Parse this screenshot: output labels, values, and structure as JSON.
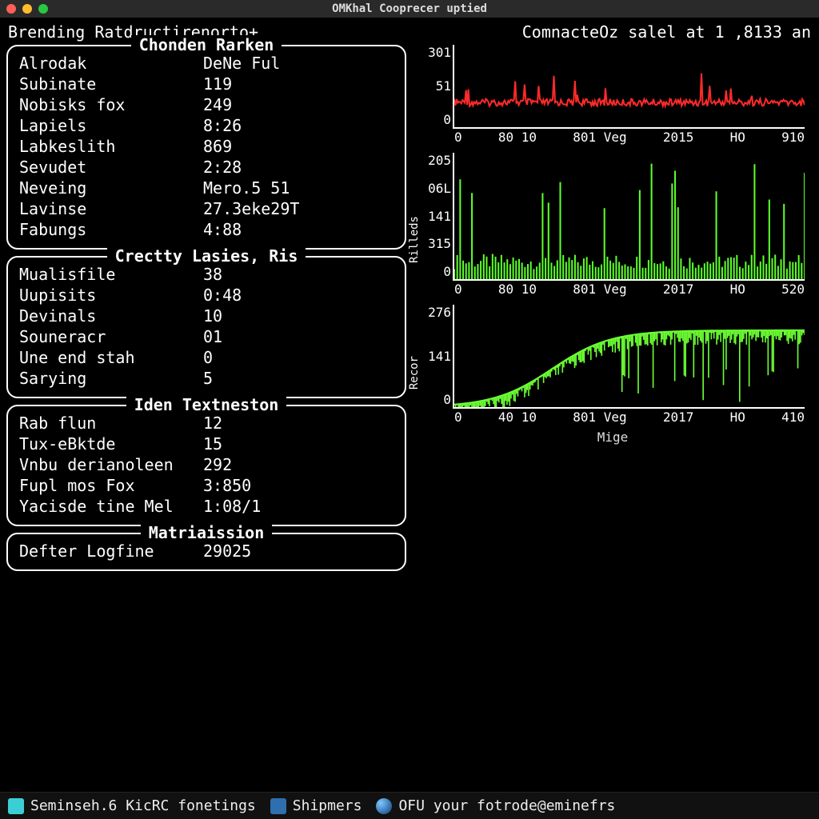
{
  "window": {
    "title": "OMKhal Cooprecer uptied"
  },
  "header": {
    "left": "Brending Ratdructirenorto+",
    "right": "ComnacteOz salel at 1 ,8133 an"
  },
  "panels": [
    {
      "title": "Chonden Rarken",
      "rows": [
        {
          "label": "Alrodak",
          "value": "DeNe Ful"
        },
        {
          "label": "Subinate",
          "value": "119"
        },
        {
          "label": "Nobisks fox",
          "value": "249"
        },
        {
          "label": "Lapiels",
          "value": "8:26"
        },
        {
          "label": "Labkeslith",
          "value": "869"
        },
        {
          "label": "Sevudet",
          "value": "2:28"
        },
        {
          "label": "Neveing",
          "value": "Mero.5 51"
        },
        {
          "label": "Lavinse",
          "value": "27.3eke29T"
        },
        {
          "label": "Fabungs",
          "value": "4:88"
        }
      ]
    },
    {
      "title": "Crectty Lasies, Ris",
      "rows": [
        {
          "label": "Mualisfile",
          "value": "38"
        },
        {
          "label": "Uupisits",
          "value": "0:48"
        },
        {
          "label": "Devinals",
          "value": "10"
        },
        {
          "label": "Souneracr",
          "value": "01"
        },
        {
          "label": "Une end stah",
          "value": "0"
        },
        {
          "label": "Sarying",
          "value": "5"
        }
      ]
    },
    {
      "title": "Iden Textneston",
      "rows": [
        {
          "label": "Rab flun",
          "value": "12"
        },
        {
          "label": "Tux-eBktde",
          "value": "15"
        },
        {
          "label": " Vnbu derianoleen",
          "value": "292"
        },
        {
          "label": "Fupl mos Fox",
          "value": "3:850"
        },
        {
          "label": "Yacisde tine Mel",
          "value": "1:08/1"
        }
      ]
    },
    {
      "title": "Matriaission",
      "rows": [
        {
          "label": "Defter Logfine",
          "value": "29025"
        }
      ]
    }
  ],
  "charts_xlabel": "Mige",
  "taskbar": {
    "items": [
      {
        "icon": "app",
        "text": "Seminseh.6 KicRC fonetings"
      },
      {
        "icon": "ship",
        "text": "Shipmers"
      },
      {
        "icon": "globe",
        "text": "OFU your fotrode@eminefrs"
      }
    ]
  },
  "chart_data": [
    {
      "type": "line",
      "color": "#ff2a2a",
      "yticks": [
        "301",
        "51",
        "0"
      ],
      "xticks": [
        "0",
        "80 10",
        "801 Veg",
        "2015",
        "HO",
        "910"
      ],
      "baseline": 0.7,
      "amplitude": 0.22,
      "spikes": 26,
      "ylabel": ""
    },
    {
      "type": "spikes",
      "color": "#5cff2a",
      "yticks": [
        "205",
        "06L",
        "141",
        "315",
        "0"
      ],
      "xticks": [
        "0",
        "80 10",
        "801 Veg",
        "2017",
        "HO",
        "520"
      ],
      "count": 120,
      "ylabel": "Rilleds"
    },
    {
      "type": "growth",
      "color": "#6bff33",
      "yticks": [
        "276",
        "141",
        "0"
      ],
      "xticks": [
        "0",
        "40 10",
        "801 Veg",
        "2017",
        "HO",
        "410"
      ],
      "ylabel": "Recor"
    }
  ]
}
